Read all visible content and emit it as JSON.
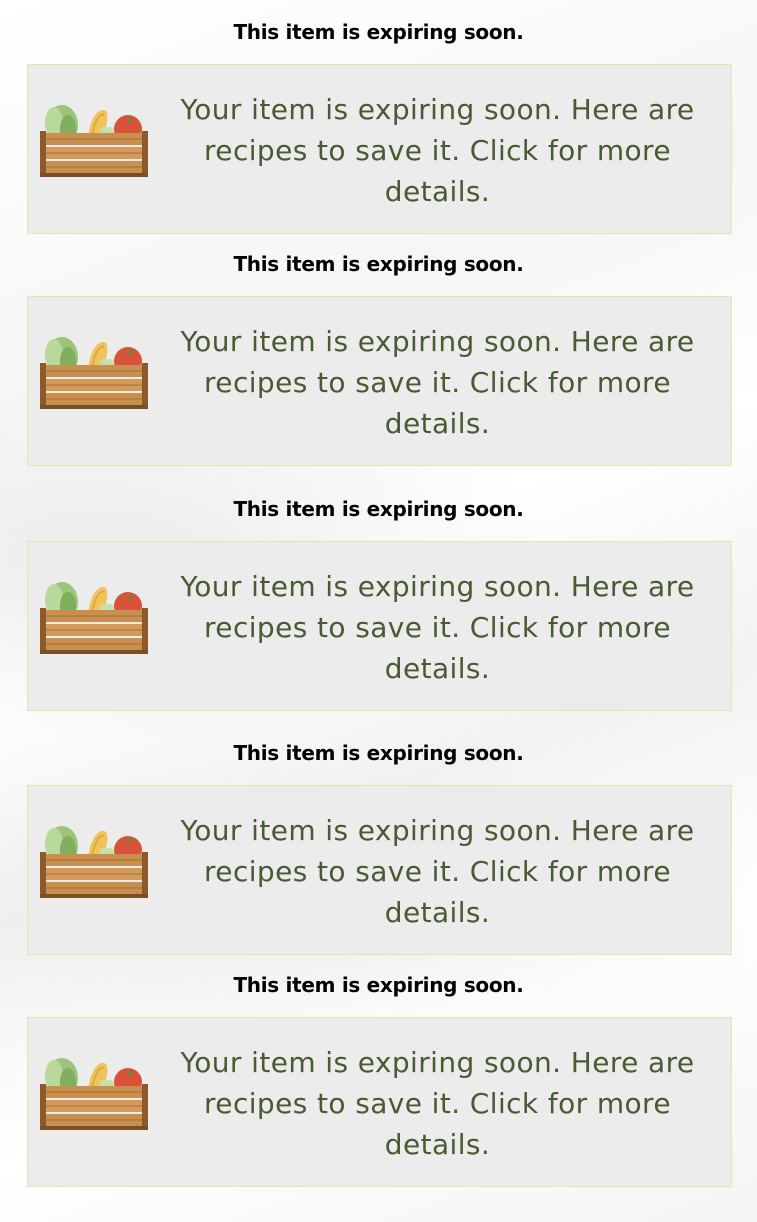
{
  "notices": [
    {
      "heading": "This item is expiring soon.",
      "message": "Your item is expiring soon. Here are recipes to save it. Click for more details.",
      "icon": "produce-crate-icon"
    },
    {
      "heading": "This item is expiring soon.",
      "message": "Your item is expiring soon. Here are recipes to save it. Click for more details.",
      "icon": "produce-crate-icon"
    },
    {
      "heading": "This item is expiring soon.",
      "message": "Your item is expiring soon. Here are recipes to save it. Click for more details.",
      "icon": "produce-crate-icon"
    },
    {
      "heading": "This item is expiring soon.",
      "message": "Your item is expiring soon. Here are recipes to save it. Click for more details.",
      "icon": "produce-crate-icon"
    },
    {
      "heading": "This item is expiring soon.",
      "message": "Your item is expiring soon. Here are recipes to save it. Click for more details.",
      "icon": "produce-crate-icon"
    }
  ],
  "colors": {
    "card_background": "#ececec",
    "card_border": "#d9ecb0",
    "message_text": "#4a5a33",
    "heading_text": "#000000"
  }
}
